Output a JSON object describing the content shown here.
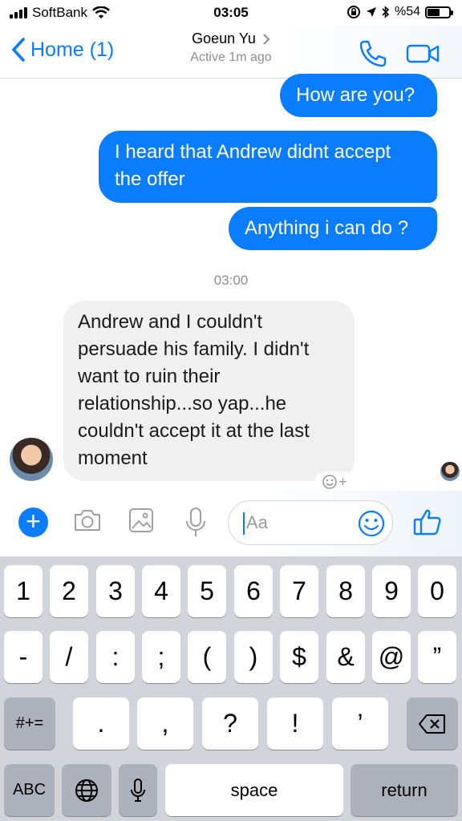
{
  "status_bar": {
    "carrier": "SoftBank",
    "time": "03:05",
    "battery_label": "%54",
    "battery_level": 0.54
  },
  "nav": {
    "back_label": "Home (1)",
    "contact_name": "Goeun Yu",
    "status": "Active 1m ago",
    "accent_color": "#0a7cff"
  },
  "messages": {
    "m1": "How are you?",
    "m2": "I heard that Andrew didnt accept the offer",
    "m3": "Anything i can do ?",
    "timestamp": "03:00",
    "m4": "Andrew and I couldn't persuade his family. I didn't want to ruin their relationship...so yap...he couldn't accept it at the last moment"
  },
  "composer": {
    "placeholder": "Aa",
    "icons": [
      "plus-icon",
      "camera-icon",
      "gallery-icon",
      "microphone-icon",
      "emoji-icon",
      "thumbs-up-icon"
    ]
  },
  "keyboard": {
    "row1": [
      "1",
      "2",
      "3",
      "4",
      "5",
      "6",
      "7",
      "8",
      "9",
      "0"
    ],
    "row2": [
      "-",
      "/",
      ":",
      ";",
      "(",
      ")",
      "$",
      "&",
      "@",
      "”"
    ],
    "row3": [
      ".",
      ",",
      "?",
      "!",
      "’"
    ],
    "symbols_label": "#+=",
    "abc_label": "ABC",
    "space_label": "space",
    "return_label": "return"
  }
}
